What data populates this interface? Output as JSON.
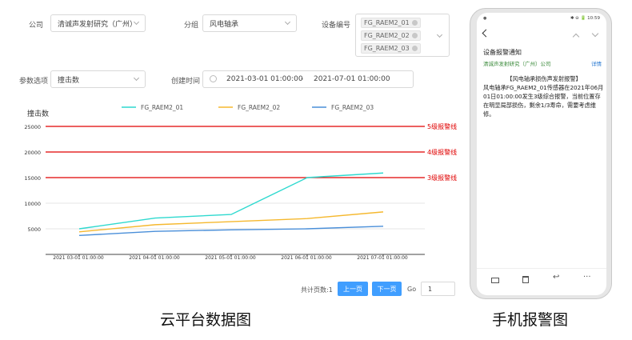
{
  "filters": {
    "company": {
      "label": "公司",
      "value": "清诚声发射研究（广州）"
    },
    "group": {
      "label": "分组",
      "value": "风电轴承"
    },
    "device": {
      "label": "设备编号",
      "tags": [
        "FG_RAEM2_01",
        "FG_RAEM2_02",
        "FG_RAEM2_03"
      ]
    },
    "param": {
      "label": "参数选项",
      "value": "撞击数"
    },
    "created": {
      "label": "创建时间",
      "start": "2021-03-01 01:00:00",
      "separator": "-",
      "end": "2021-07-01 01:00:00"
    }
  },
  "chart_data": {
    "type": "line",
    "ylabel": "撞击数",
    "x": [
      "2021 03-01 01:00:00",
      "2021 04-01 01:00:00",
      "2021 05-01 01:00:00",
      "2021 06-01 01:00:00",
      "2021 07-01 01:00:00"
    ],
    "ylim": [
      0,
      25000
    ],
    "yticks": [
      5000,
      10000,
      15000,
      20000,
      25000
    ],
    "grid": true,
    "legend_position": "top",
    "series": [
      {
        "name": "FG_RAEM2_01",
        "color": "#2ed9cf",
        "points": [
          [
            0,
            5000
          ],
          [
            1,
            7100
          ],
          [
            2,
            7800
          ],
          [
            3,
            15000
          ],
          [
            4,
            15900
          ]
        ]
      },
      {
        "name": "FG_RAEM2_02",
        "color": "#f5b82e",
        "points": [
          [
            0,
            4400
          ],
          [
            1,
            5800
          ],
          [
            2,
            6400
          ],
          [
            3,
            7000
          ],
          [
            4,
            8300
          ]
        ]
      },
      {
        "name": "FG_RAEM2_03",
        "color": "#4a8fd9",
        "points": [
          [
            0,
            3700
          ],
          [
            1,
            4500
          ],
          [
            2,
            4800
          ],
          [
            3,
            5000
          ],
          [
            4,
            5500
          ]
        ]
      }
    ],
    "thresholds": [
      {
        "value": 25000,
        "label": "5级报警线",
        "color": "#e00000"
      },
      {
        "value": 20000,
        "label": "4级报警线",
        "color": "#e00000"
      },
      {
        "value": 15000,
        "label": "3级报警线",
        "color": "#e00000"
      }
    ]
  },
  "pagination": {
    "total_label": "共计页数:1",
    "prev": "上一页",
    "next": "下一页",
    "go_label": "Go",
    "page_value": "1"
  },
  "captions": {
    "left": "云平台数据图",
    "right": "手机报警图"
  },
  "phone": {
    "status_left": "●",
    "status_right": "✱ ⊖ 🔋 10:59",
    "title": "设备报警通知",
    "sender": "清诚声发射研究（广州）公司",
    "detail_link": "详情",
    "message_title": "【风电轴承损伤声发射报警】",
    "message_body": "风电轴承FG_RAEM2_01传感器在2021年06月01日01:00:00发生3级综合报警，当前位置存在明显局部损伤，剩余1/3寿命，需要考虑维修。"
  }
}
